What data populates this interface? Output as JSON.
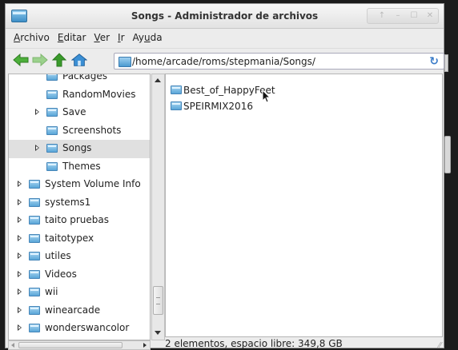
{
  "window": {
    "title": "Songs - Administrador de archivos"
  },
  "titlebar_buttons": [
    {
      "name": "up",
      "glyph": "↑"
    },
    {
      "name": "minimize",
      "glyph": "–"
    },
    {
      "name": "maximize",
      "glyph": "☐"
    },
    {
      "name": "close",
      "glyph": "✕"
    }
  ],
  "menu": [
    {
      "underline": "A",
      "rest": "rchivo"
    },
    {
      "underline": "E",
      "rest": "ditar"
    },
    {
      "underline": "V",
      "rest": "er"
    },
    {
      "underline": "I",
      "rest": "r"
    },
    {
      "pre": "Ay",
      "underline": "u",
      "rest": "da"
    }
  ],
  "toolbar": {
    "path": "/home/arcade/roms/stepmania/Songs/",
    "colors": {
      "back": "#4caf3a",
      "forward": "#9bd18c",
      "up": "#3a9a2b",
      "home": "#3b8fd4"
    }
  },
  "sidebar": {
    "items": [
      {
        "label": "Packages",
        "level": 2,
        "expander": false,
        "selected": false
      },
      {
        "label": "RandomMovies",
        "level": 2,
        "expander": false,
        "selected": false
      },
      {
        "label": "Save",
        "level": 2,
        "expander": true,
        "selected": false
      },
      {
        "label": "Screenshots",
        "level": 2,
        "expander": false,
        "selected": false
      },
      {
        "label": "Songs",
        "level": 2,
        "expander": true,
        "selected": true
      },
      {
        "label": "Themes",
        "level": 2,
        "expander": false,
        "selected": false
      },
      {
        "label": "System Volume Info",
        "level": 1,
        "expander": true,
        "selected": false
      },
      {
        "label": "systems1",
        "level": 1,
        "expander": true,
        "selected": false
      },
      {
        "label": "taito pruebas",
        "level": 1,
        "expander": true,
        "selected": false
      },
      {
        "label": "taitotypex",
        "level": 1,
        "expander": true,
        "selected": false
      },
      {
        "label": "utiles",
        "level": 1,
        "expander": true,
        "selected": false
      },
      {
        "label": "Videos",
        "level": 1,
        "expander": true,
        "selected": false
      },
      {
        "label": "wii",
        "level": 1,
        "expander": true,
        "selected": false
      },
      {
        "label": "winearcade",
        "level": 1,
        "expander": true,
        "selected": false
      },
      {
        "label": "wonderswancolor",
        "level": 1,
        "expander": true,
        "selected": false
      }
    ]
  },
  "files": [
    {
      "label": "Best_of_HappyFeet"
    },
    {
      "label": "SPEIRMIX2016"
    }
  ],
  "status": {
    "text": "2 elementos, espacio libre: 349,8 GB"
  }
}
